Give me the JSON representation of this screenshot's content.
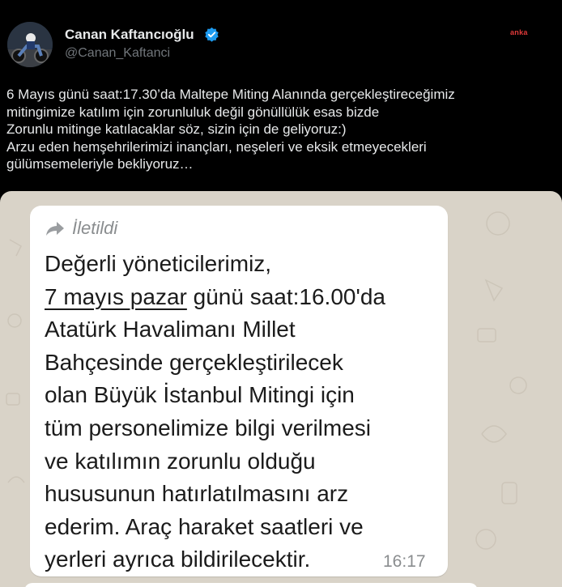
{
  "author": {
    "display_name": "Canan Kaftancıoğlu",
    "handle": "@Canan_Kaftanci",
    "verified": true,
    "verified_color": "#1d9bf0"
  },
  "watermark": "anka",
  "tweet": {
    "text": "6 Mayıs günü saat:17.30’da Maltepe Miting Alanında gerçekleştireceğimiz\nmitingimize katılım için zorunluluk değil gönüllülük esas bizde\nZorunlu mitinge katılacaklar söz, sizin için de geliyoruz:)\nArzu eden hemşehrilerimizi inançları, neşeleri ve eksik etmeyecekleri\ngülümsemeleriyle bekliyoruz…"
  },
  "screenshot": {
    "forwarded_label": "İletildi",
    "message_lines": [
      "Değerli yöneticilerimiz,",
      "7 mayıs pazar",
      " günü saat:16.00'da",
      "Atatürk Havalimanı Millet",
      "Bahçesinde gerçekleştirilecek",
      "olan Büyük İstanbul Mitingi için",
      "tüm personelimize bilgi verilmesi",
      "ve katılımın zorunlu olduğu",
      "hususunun hatırlatılmasını arz",
      "ederim. Araç haraket saatleri ve",
      "yerleri ayrıca bildirilecektir."
    ],
    "time": "16:17"
  },
  "colors": {
    "background": "#000000",
    "text": "#e7e9ea",
    "secondary": "#71767b",
    "whatsapp_bg": "#d9d3c8",
    "bubble": "#ffffff"
  }
}
